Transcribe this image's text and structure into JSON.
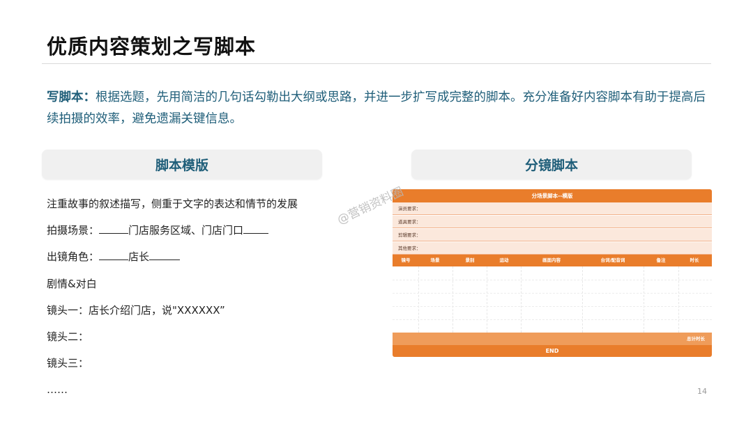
{
  "slide": {
    "title": "优质内容策划之写脚本",
    "intro_lead": "写脚本：",
    "intro_text": "根据选题，先用简洁的几句话勾勒出大纲或思路，并进一步扩写成完整的脚本。充分准备好内容脚本有助于提高后续拍摄的效率，避免遗漏关键信息。",
    "page_number": "14"
  },
  "template": {
    "heading": "脚本模版",
    "lines": [
      {
        "id": "emphasis",
        "text": "注重故事的叙述描写，侧重于文字的表达和情节的发展"
      },
      {
        "id": "scene",
        "label": "拍摄场景：",
        "value": "门店服务区域、门店门口"
      },
      {
        "id": "role",
        "label": "出镜角色：",
        "value": "店长"
      },
      {
        "id": "plot",
        "text": "剧情&对白"
      },
      {
        "id": "shot1",
        "text": "镜头一：店长介绍门店，说\"XXXXXX”"
      },
      {
        "id": "shot2",
        "text": "镜头二："
      },
      {
        "id": "shot3",
        "text": "镜头三："
      },
      {
        "id": "more",
        "text": "……"
      }
    ]
  },
  "storyboard": {
    "heading": "分镜脚本",
    "table_title": "分场景脚本--模版",
    "requirements": [
      "演员要求：",
      "道具要求：",
      "剪辑要求：",
      "其他要求："
    ],
    "columns": [
      "镜号",
      "场景",
      "景别",
      "运动",
      "画面内容",
      "台词/配音词",
      "备注",
      "时长"
    ],
    "total_label": "总计时长",
    "end_label": "END",
    "colors": {
      "accent": "#e97d2b",
      "light": "#fbe8dc",
      "total": "#ef9c5a"
    }
  },
  "watermark": "@营销资料圈"
}
